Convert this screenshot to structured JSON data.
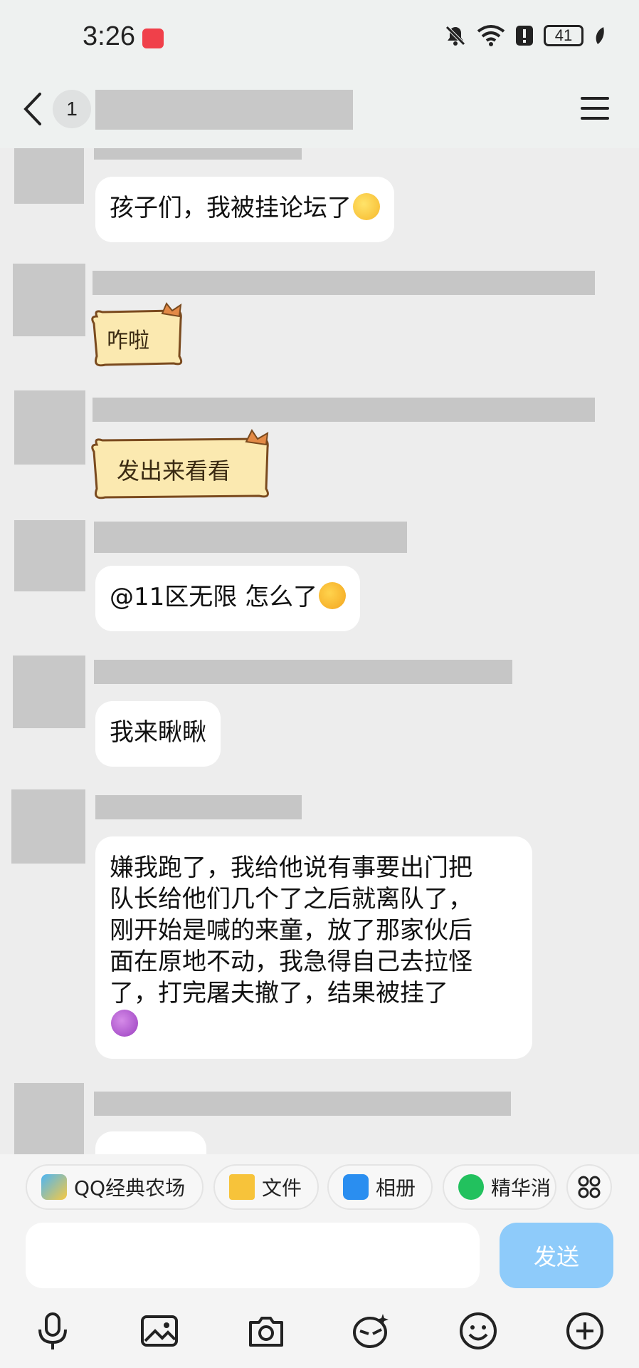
{
  "status_bar": {
    "time": "3:26",
    "battery": "41"
  },
  "header": {
    "unread_badge": "1"
  },
  "messages": [
    {
      "type": "text",
      "text": "孩子们，我被挂论坛了",
      "emoji": "thinking-face"
    },
    {
      "type": "sticker",
      "text": "咋啦"
    },
    {
      "type": "sticker",
      "text": "发出来看看"
    },
    {
      "type": "text",
      "text": "@11区无限 怎么了",
      "emoji": "flushed-face"
    },
    {
      "type": "text",
      "text": "我来瞅瞅"
    },
    {
      "type": "text",
      "lines": [
        "嫌我跑了，我给他说有事要出门把",
        "队长给他们几个了之后就离队了，",
        "刚开始是喊的来童，放了那家伙后",
        "面在原地不动，我急得自己去拉怪",
        "了，打完屠夫撤了，结果被挂了"
      ],
      "emoji": "purple-grimace"
    }
  ],
  "quick_actions": [
    {
      "label": "QQ经典农场",
      "icon": "farm-app-icon"
    },
    {
      "label": "文件",
      "icon": "folder-icon"
    },
    {
      "label": "相册",
      "icon": "photo-icon"
    },
    {
      "label": "精华消",
      "icon": "star-badge-icon"
    }
  ],
  "composer": {
    "send_label": "发送"
  },
  "toolbar_icons": [
    "microphone-icon",
    "image-icon",
    "camera-icon",
    "sticker-icon",
    "emoji-icon",
    "plus-icon"
  ],
  "colors": {
    "send_button": "#8ecbfa",
    "bubble": "#ffffff",
    "background": "#ededed"
  }
}
